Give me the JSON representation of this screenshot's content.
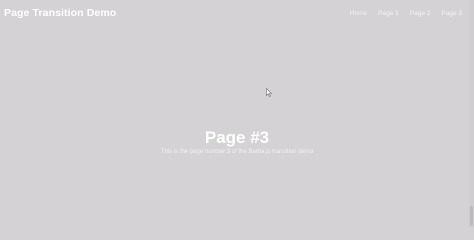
{
  "navbar": {
    "brand": "Page Transition Demo",
    "links": [
      {
        "label": "Home"
      },
      {
        "label": "Page 1"
      },
      {
        "label": "Page 2"
      },
      {
        "label": "Page 3"
      }
    ]
  },
  "hero": {
    "title": "Page #3",
    "subtitle": "This is the page number 3 of the Barba.js transition demo"
  },
  "colors": {
    "background": "#d4d2d4",
    "text": "#ffffff"
  }
}
